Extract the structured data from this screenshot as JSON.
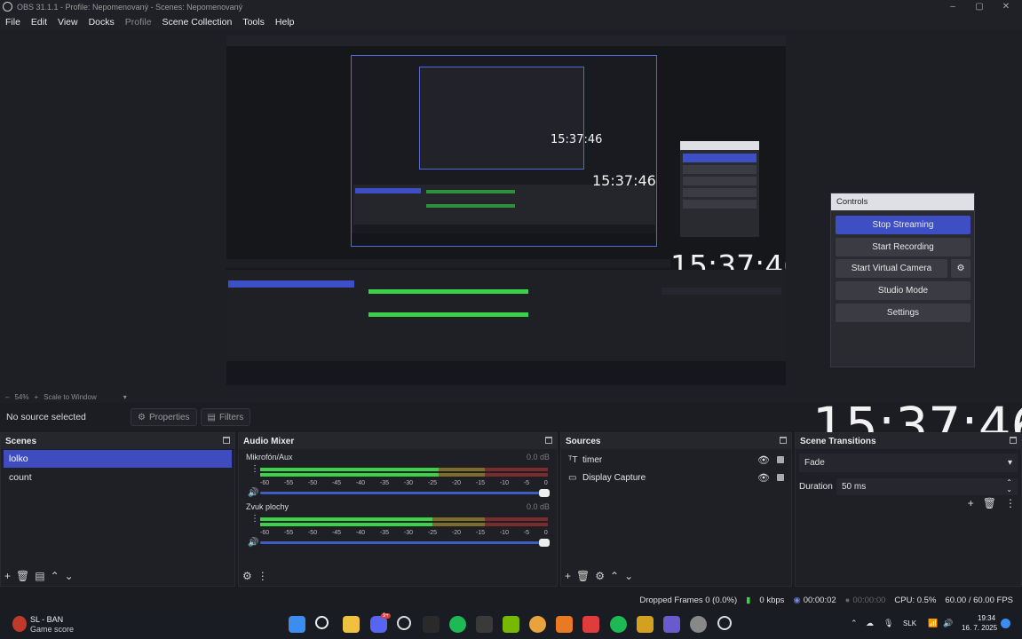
{
  "window": {
    "title": "OBS 31.1.1 - Profile: Nepomenovaný - Scenes: Nepomenovaný"
  },
  "menu": [
    "File",
    "Edit",
    "View",
    "Docks",
    "Profile",
    "Scene Collection",
    "Tools",
    "Help"
  ],
  "preview": {
    "zoom": "54%",
    "scale_mode": "Scale to Window",
    "clock_large": "15:37:46",
    "clock_canvas": "15:37:46",
    "clock_nested": "15:37:46",
    "clock_nested2": "15:37:46"
  },
  "source_bar": {
    "label": "No source selected",
    "properties": "Properties",
    "filters": "Filters"
  },
  "scenes": {
    "title": "Scenes",
    "items": [
      "lolko",
      "count"
    ]
  },
  "audio_mixer": {
    "title": "Audio Mixer",
    "channels": [
      {
        "name": "Mikrofón/Aux",
        "db": "0.0 dB",
        "level": 0.62
      },
      {
        "name": "Zvuk plochy",
        "db": "0.0 dB",
        "level": 0.6
      }
    ],
    "ticks": [
      "-60",
      "-55",
      "-50",
      "-45",
      "-40",
      "-35",
      "-30",
      "-25",
      "-20",
      "-15",
      "-10",
      "-5",
      "0"
    ]
  },
  "sources": {
    "title": "Sources",
    "items": [
      {
        "name": "timer",
        "icon": "text-icon"
      },
      {
        "name": "Display Capture",
        "icon": "monitor-icon"
      }
    ]
  },
  "transitions": {
    "title": "Scene Transitions",
    "selected": "Fade",
    "duration_label": "Duration",
    "duration_value": "50 ms"
  },
  "controls": {
    "title": "Controls",
    "stop_streaming": "Stop Streaming",
    "start_recording": "Start Recording",
    "start_virtual_camera": "Start Virtual Camera",
    "studio_mode": "Studio Mode",
    "settings": "Settings"
  },
  "status": {
    "dropped_frames": "Dropped Frames 0 (0.0%)",
    "kbps": "0 kbps",
    "stream_time": "00:00:02",
    "rec_time": "00:00:00",
    "cpu": "CPU: 0.5%",
    "fps": "60.00 / 60.00 FPS"
  },
  "taskbar": {
    "app_name": "SL - BAN",
    "app_sub": "Game score",
    "lang": "SLK",
    "time": "19:34",
    "date": "16. 7. 2025",
    "discord_badge": "9+"
  },
  "colors": {
    "accent": "#3e4ec4",
    "meter_green": "#3bd24a",
    "meter_yellow": "#7b6e2a",
    "meter_red": "#7a2b2b"
  }
}
